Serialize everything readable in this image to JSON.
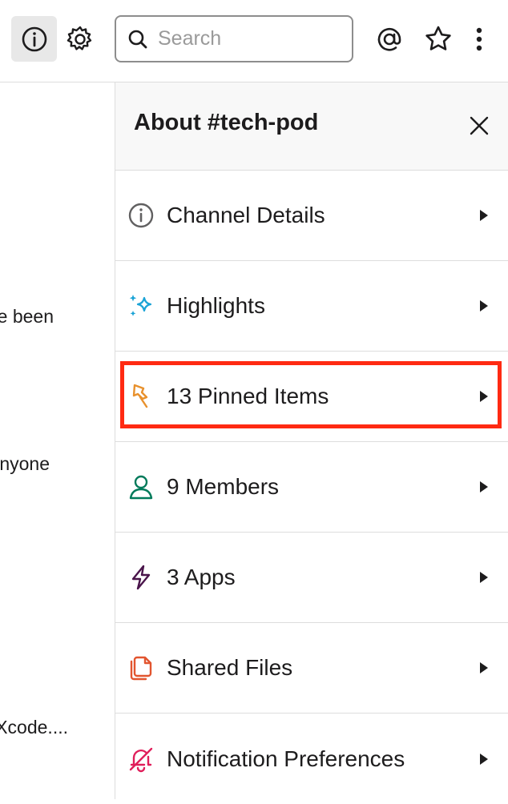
{
  "toolbar": {
    "search_placeholder": "Search",
    "icons": [
      "info-icon",
      "gear-icon",
      "search-icon",
      "at-icon",
      "star-icon",
      "more-vertical-icon"
    ]
  },
  "messages": {
    "fragments": [
      "e been",
      "nyone",
      "Xcode...."
    ]
  },
  "panel": {
    "title": "About #tech-pod",
    "items": [
      {
        "label": "Channel Details",
        "icon": "info-circle-icon",
        "color": "#616061"
      },
      {
        "label": "Highlights",
        "icon": "sparkles-icon",
        "color": "#1aa3d6"
      },
      {
        "label": "13 Pinned Items",
        "icon": "pin-icon",
        "color": "#e8912d"
      },
      {
        "label": "9 Members",
        "icon": "person-icon",
        "color": "#007a5a"
      },
      {
        "label": "3 Apps",
        "icon": "lightning-icon",
        "color": "#4a154b"
      },
      {
        "label": "Shared Files",
        "icon": "files-icon",
        "color": "#e2552f"
      },
      {
        "label": "Notification Preferences",
        "icon": "bell-off-icon",
        "color": "#e01e5a"
      }
    ]
  },
  "highlight_color": "#ff2a12"
}
